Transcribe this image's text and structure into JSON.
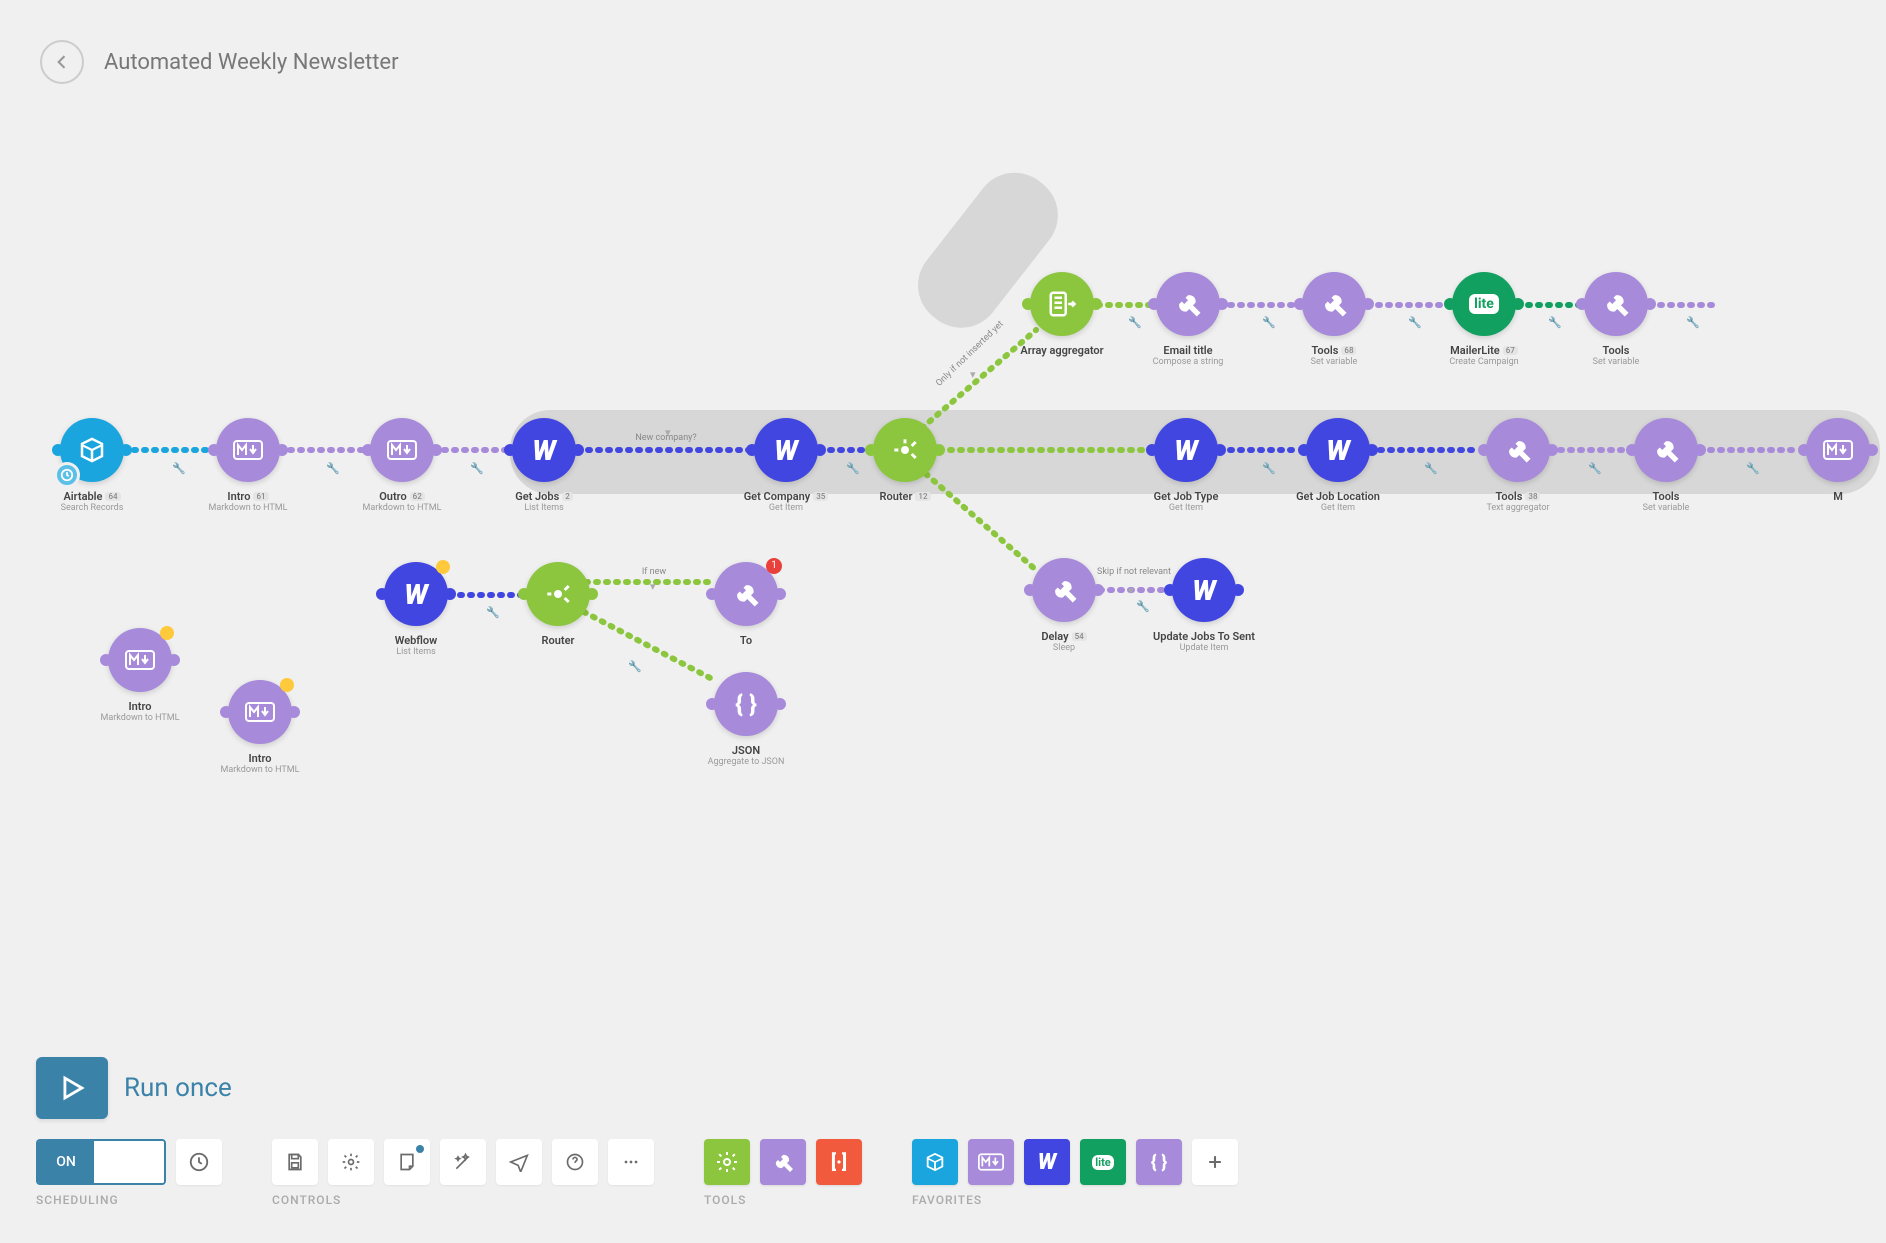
{
  "header": {
    "title": "Automated Weekly Newsletter"
  },
  "run": {
    "label": "Run once"
  },
  "toggle": {
    "on": "ON"
  },
  "groups": {
    "scheduling": "SCHEDULING",
    "controls": "CONTROLS",
    "tools": "TOOLS",
    "favorites": "FAVORITES"
  },
  "edge_labels": {
    "new_company": "New company?",
    "if_not_inserted": "Only if not inserted yet",
    "if_new": "If new",
    "skip_relevant": "Skip if not relevant"
  },
  "colors": {
    "webflow": "#4146e0",
    "tools_purple": "#a78bda",
    "router_green": "#8cc63f",
    "airtable_teal": "#1aa5de",
    "mailerlite_green": "#11a05f",
    "json_orange": "#f15a3c",
    "run_blue": "#3a82a8"
  },
  "nodes": {
    "airtable": {
      "title": "Airtable",
      "sub": "Search Records",
      "badge": "64"
    },
    "intro_md_1": {
      "title": "Intro",
      "sub": "Markdown to HTML",
      "badge": "61"
    },
    "outro_md": {
      "title": "Outro",
      "sub": "Markdown to HTML",
      "badge": "62"
    },
    "get_jobs": {
      "title": "Get Jobs",
      "sub": "List Items",
      "badge": "2"
    },
    "get_company": {
      "title": "Get Company",
      "sub": "Get Item",
      "badge": "35"
    },
    "router_main": {
      "title": "Router",
      "sub": "",
      "badge": "12"
    },
    "array_agg": {
      "title": "Array aggregator",
      "sub": "",
      "badge": ""
    },
    "email_title": {
      "title": "Email title",
      "sub": "Compose a string",
      "badge": ""
    },
    "tools_t1": {
      "title": "Tools",
      "sub": "Set variable",
      "badge": "68"
    },
    "mailerlite": {
      "title": "MailerLite",
      "sub": "Create Campaign",
      "badge": "67"
    },
    "tools_t2": {
      "title": "Tools",
      "sub": "Set variable",
      "badge": ""
    },
    "get_job_type": {
      "title": "Get Job Type",
      "sub": "Get Item",
      "badge": ""
    },
    "get_job_loc": {
      "title": "Get Job Location",
      "sub": "Get Item",
      "badge": ""
    },
    "tools_mid": {
      "title": "Tools",
      "sub": "Text aggregator",
      "badge": "38"
    },
    "tools_right": {
      "title": "Tools",
      "sub": "Set variable",
      "badge": ""
    },
    "m_right": {
      "title": "M",
      "sub": "",
      "badge": ""
    },
    "delay": {
      "title": "Delay",
      "sub": "Sleep",
      "badge": "54"
    },
    "update_jobs": {
      "title": "Update Jobs To Sent",
      "sub": "Update Item",
      "badge": ""
    },
    "webflow_lower": {
      "title": "Webflow",
      "sub": "List Items",
      "badge": ""
    },
    "router_lower": {
      "title": "Router",
      "sub": "",
      "badge": ""
    },
    "tools_lower": {
      "title": "To",
      "sub": "",
      "badge": "1"
    },
    "json_node": {
      "title": "JSON",
      "sub": "Aggregate to JSON",
      "badge": ""
    },
    "intro_y1": {
      "title": "Intro",
      "sub": "Markdown to HTML",
      "badge": ""
    },
    "intro_y2": {
      "title": "Intro",
      "sub": "Markdown to HTML",
      "badge": ""
    }
  },
  "favorites": [
    "airtable",
    "markdown",
    "webflow",
    "mailerlite",
    "json",
    "add"
  ]
}
